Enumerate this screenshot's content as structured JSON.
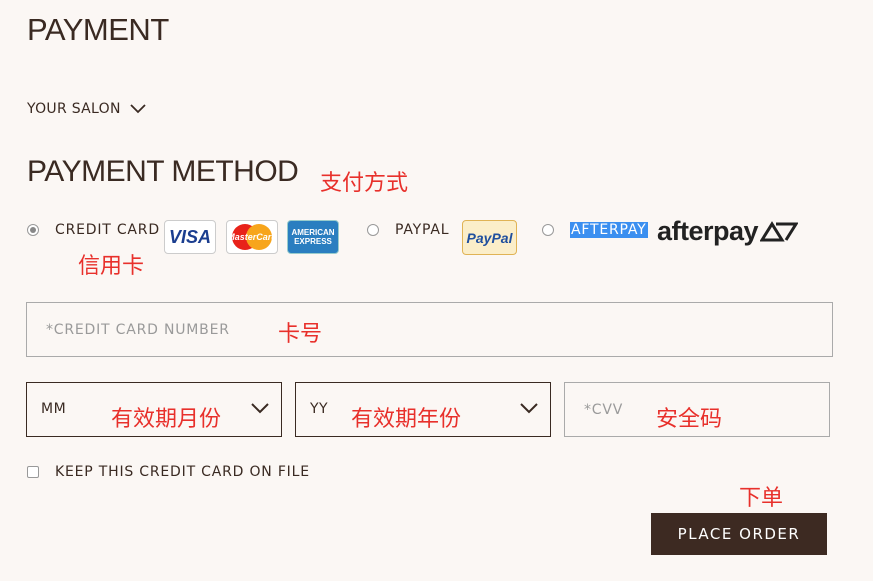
{
  "header": {
    "title": "PAYMENT"
  },
  "salon": {
    "label": "YOUR SALON"
  },
  "method": {
    "title": "PAYMENT METHOD",
    "annotation": "支付方式"
  },
  "options": {
    "credit_card": {
      "label": "CREDIT CARD",
      "annotation": "信用卡",
      "selected": true
    },
    "paypal": {
      "label": "PAYPAL",
      "selected": false
    },
    "afterpay": {
      "label": "AFTERPAY",
      "selected": false
    }
  },
  "logos": {
    "visa": "VISA",
    "mastercard": "MasterCard",
    "amex_line1": "AMERICAN",
    "amex_line2": "EXPRESS",
    "paypal": "PayPal",
    "afterpay": "afterpay"
  },
  "card_number": {
    "placeholder": "*CREDIT CARD NUMBER",
    "annotation": "卡号"
  },
  "expiry_month": {
    "value": "MM",
    "annotation": "有效期月份"
  },
  "expiry_year": {
    "value": "YY",
    "annotation": "有效期年份"
  },
  "cvv": {
    "placeholder": "*CVV",
    "annotation": "安全码"
  },
  "keep_card": {
    "label": "KEEP THIS CREDIT CARD ON FILE",
    "checked": false
  },
  "place_order": {
    "label": "PLACE ORDER",
    "annotation": "下单"
  },
  "colors": {
    "accent": "#3d2a22",
    "annotation": "#e8302b",
    "background": "#fbf7f4",
    "afterpay_highlight": "#3b8ff0"
  }
}
